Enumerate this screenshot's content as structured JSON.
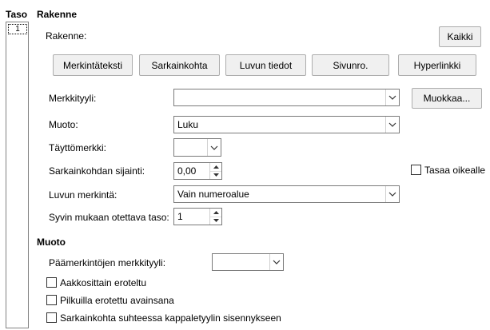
{
  "level": {
    "heading": "Taso",
    "selected": "1"
  },
  "structure": {
    "heading": "Rakenne",
    "label": "Rakenne:",
    "all_button": "Kaikki",
    "buttons": [
      {
        "label": "Merkintäteksti"
      },
      {
        "label": "Sarkainkohta"
      },
      {
        "label": "Luvun tiedot"
      },
      {
        "label": "Sivunro."
      },
      {
        "label": "Hyperlinkki"
      }
    ]
  },
  "fields": {
    "char_style_label": "Merkkityyli:",
    "char_style_value": "",
    "edit_button": "Muokkaa...",
    "format_label": "Muoto:",
    "format_value": "Luku",
    "fill_char_label": "Täyttömerkki:",
    "fill_char_value": "",
    "tab_pos_label": "Sarkainkohdan sijainti:",
    "tab_pos_value": "0,00",
    "align_right_label": "Tasaa oikealle",
    "chapter_entry_label": "Luvun merkintä:",
    "chapter_entry_value": "Vain numeroalue",
    "eval_level_label": "Syvin mukaan otettava taso:",
    "eval_level_value": "1"
  },
  "format": {
    "heading": "Muoto",
    "main_entry_style_label": "Päämerkintöjen merkkityyli:",
    "main_entry_style_value": "",
    "options": [
      {
        "label": "Aakkosittain eroteltu",
        "checked": false
      },
      {
        "label": "Pilkuilla erotettu avainsana",
        "checked": false
      },
      {
        "label": "Sarkainkohta suhteessa kappaletyylin sisennykseen",
        "checked": false
      }
    ]
  }
}
